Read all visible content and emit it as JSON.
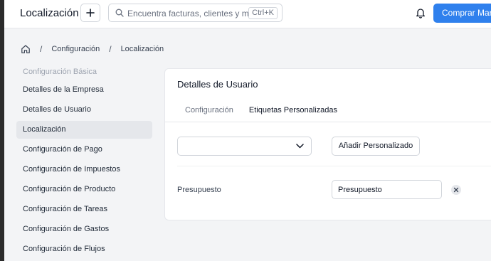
{
  "header": {
    "title": "Localización",
    "search_placeholder": "Encuentra facturas, clientes y más",
    "search_shortcut": "Ctrl+K",
    "buy_label": "Comprar Marca Blanca"
  },
  "breadcrumb": [
    "Configuración",
    "Localización"
  ],
  "sidebar": {
    "heading": "Configuración Básica",
    "items": [
      {
        "label": "Detalles de la Empresa"
      },
      {
        "label": "Detalles de Usuario"
      },
      {
        "label": "Localización",
        "active": true
      },
      {
        "label": "Configuración de Pago"
      },
      {
        "label": "Configuración de Impuestos"
      },
      {
        "label": "Configuración de Producto"
      },
      {
        "label": "Configuración de Tareas"
      },
      {
        "label": "Configuración de Gastos"
      },
      {
        "label": "Configuración de Flujos"
      }
    ]
  },
  "card": {
    "title": "Detalles de Usuario",
    "tabs": [
      {
        "label": "Configuración"
      },
      {
        "label": "Etiquetas Personalizadas",
        "active": true
      }
    ],
    "add_custom_label": "Añadir Personalizado",
    "select_value": "",
    "fields": [
      {
        "label": "Presupuesto",
        "value": "Presupuesto"
      }
    ]
  },
  "colors": {
    "accent": "#2f80ed",
    "active_item_bg": "#e5e7eb"
  }
}
